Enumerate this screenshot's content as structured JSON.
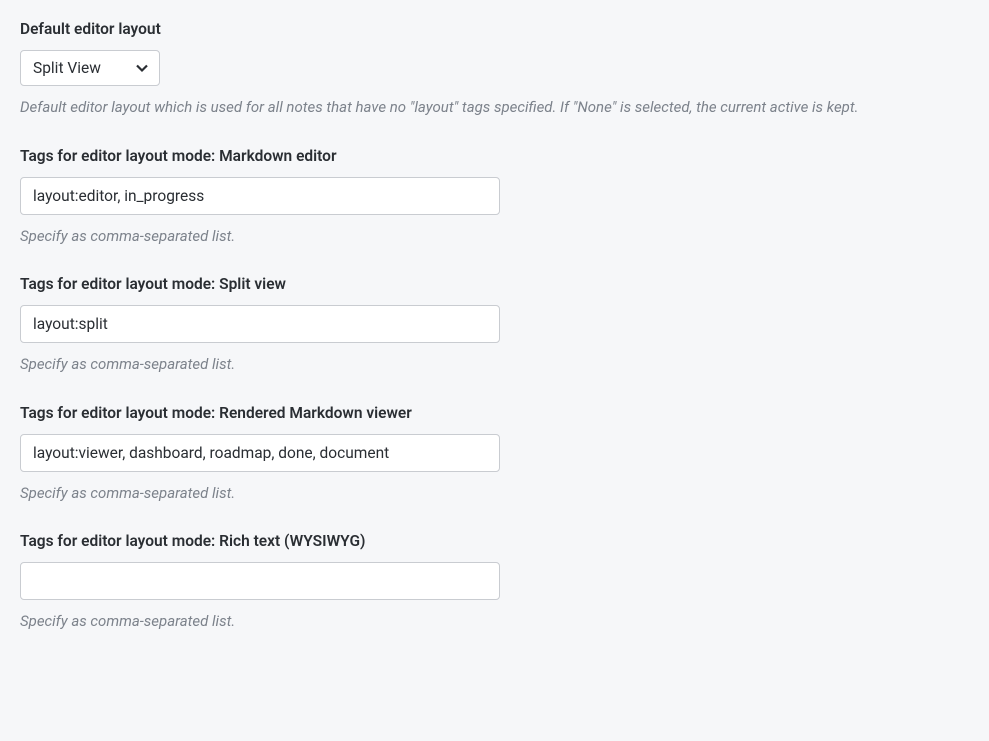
{
  "defaultLayout": {
    "label": "Default editor layout",
    "selected": "Split View",
    "help": "Default editor layout which is used for all notes that have no \"layout\" tags specified. If \"None\" is selected, the current active is kept."
  },
  "tagsMarkdownEditor": {
    "label": "Tags for editor layout mode: Markdown editor",
    "value": "layout:editor, in_progress",
    "help": "Specify as comma-separated list."
  },
  "tagsSplitView": {
    "label": "Tags for editor layout mode: Split view",
    "value": "layout:split",
    "help": "Specify as comma-separated list."
  },
  "tagsRenderedViewer": {
    "label": "Tags for editor layout mode: Rendered Markdown viewer",
    "value": "layout:viewer, dashboard, roadmap, done, document",
    "help": "Specify as comma-separated list."
  },
  "tagsRichText": {
    "label": "Tags for editor layout mode: Rich text (WYSIWYG)",
    "value": "",
    "help": "Specify as comma-separated list."
  }
}
